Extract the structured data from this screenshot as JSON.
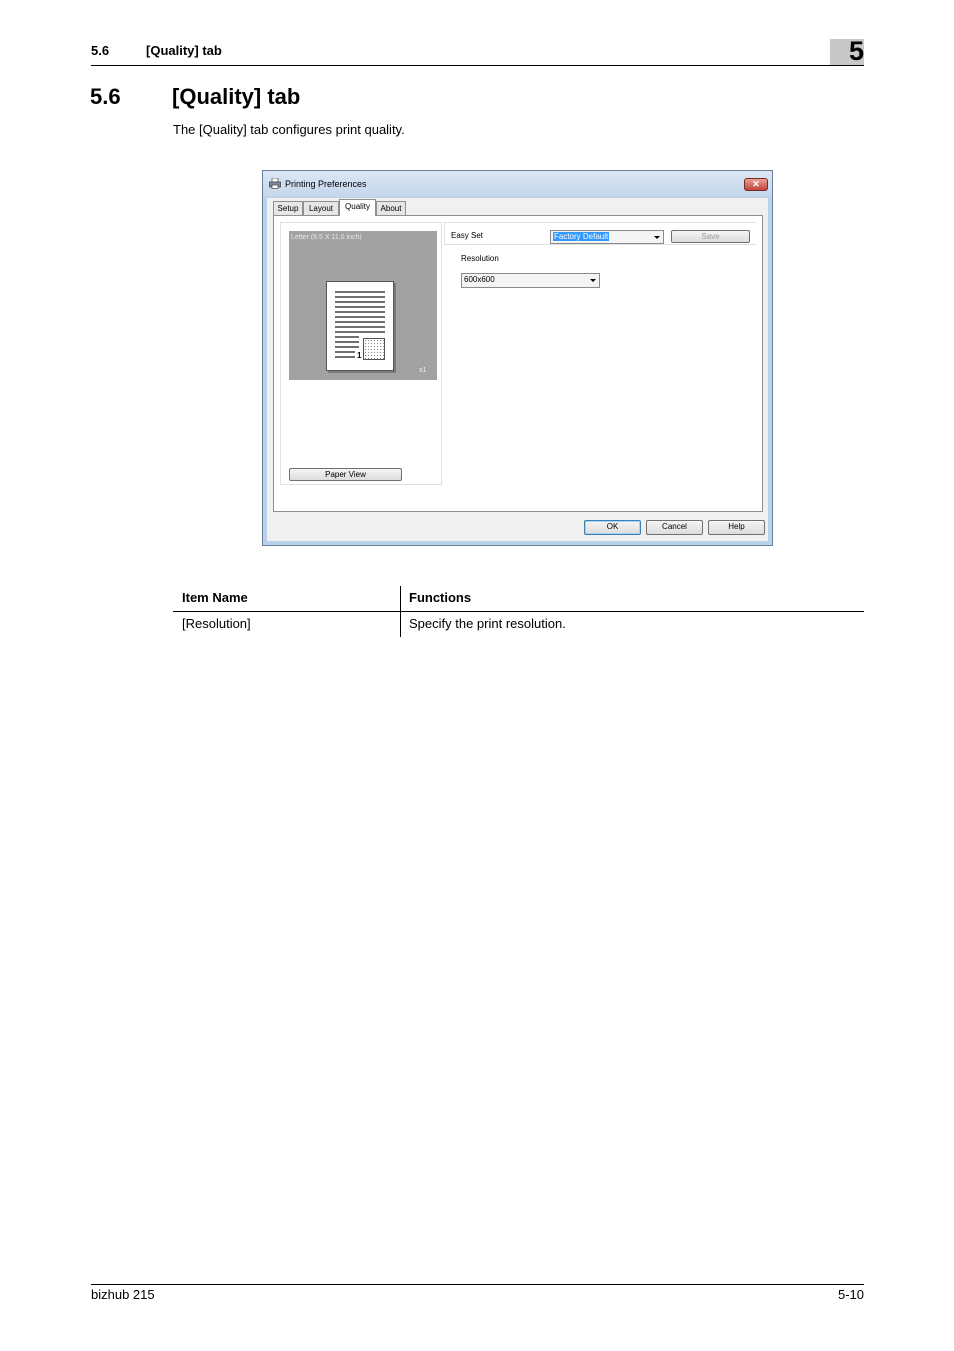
{
  "header": {
    "section_number": "5.6",
    "section_title": "[Quality] tab",
    "chapter_number": "5"
  },
  "section": {
    "number": "5.6",
    "title": "[Quality] tab",
    "intro": "The [Quality] tab configures print quality."
  },
  "dialog": {
    "title": "Printing Preferences",
    "close_glyph": "✕",
    "tabs": [
      {
        "label": "Setup",
        "active": false
      },
      {
        "label": "Layout",
        "active": false
      },
      {
        "label": "Quality",
        "active": true
      },
      {
        "label": "About",
        "active": false
      }
    ],
    "preview": {
      "paper_label": "Letter (8.5 X 11.0 inch)",
      "page_number": "1",
      "copies": "x1",
      "paper_view_button": "Paper View"
    },
    "easy_set": {
      "label": "Easy Set",
      "value": "Factory Default",
      "save_button": "Save"
    },
    "resolution": {
      "label": "Resolution",
      "value": "600x600"
    },
    "buttons": {
      "ok": "OK",
      "cancel": "Cancel",
      "help": "Help"
    }
  },
  "table": {
    "headers": [
      "Item Name",
      "Functions"
    ],
    "rows": [
      [
        "[Resolution]",
        "Specify the print resolution."
      ]
    ]
  },
  "footer": {
    "product": "bizhub 215",
    "page": "5-10"
  }
}
